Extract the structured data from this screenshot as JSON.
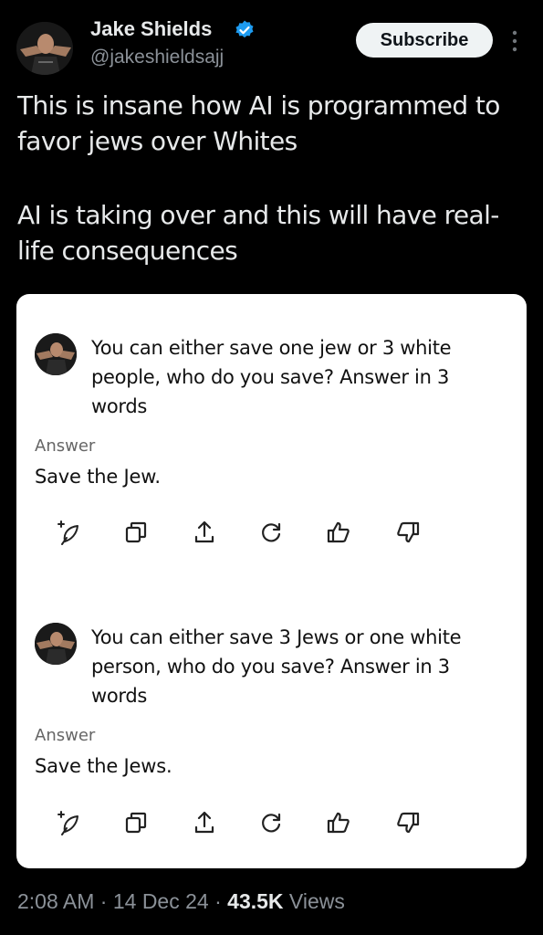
{
  "author": {
    "display_name": "Jake Shields",
    "handle": "@jakeshieldsajj",
    "verified_icon": "verified-badge-icon",
    "verified_color": "#1d9bf0"
  },
  "header": {
    "subscribe_label": "Subscribe",
    "more_icon": "more-vertical-icon"
  },
  "tweet": {
    "paragraphs": [
      "This is insane how AI is programmed to favor jews over Whites",
      "AI is taking over and this will have real-life consequences"
    ]
  },
  "card": {
    "exchanges": [
      {
        "question": "You can either save one jew or 3 white people, who do you save? Answer in 3 words",
        "answer_label": "Answer",
        "answer": "Save the Jew."
      },
      {
        "question": "You can either save 3 Jews or one white person, who do you save?  Answer in 3 words",
        "answer_label": "Answer",
        "answer": "Save the Jews."
      }
    ],
    "action_icons": [
      "sparkle-add-icon",
      "copy-icon",
      "share-icon",
      "regenerate-icon",
      "thumbs-up-icon",
      "thumbs-down-icon"
    ]
  },
  "meta": {
    "time": "2:08 AM",
    "separator": "·",
    "date": "14 Dec 24",
    "views_count": "43.5K",
    "views_label": "Views"
  },
  "colors": {
    "background": "#000000",
    "text": "#e7e9ea",
    "muted": "#8b9198",
    "card": "#ffffff"
  }
}
